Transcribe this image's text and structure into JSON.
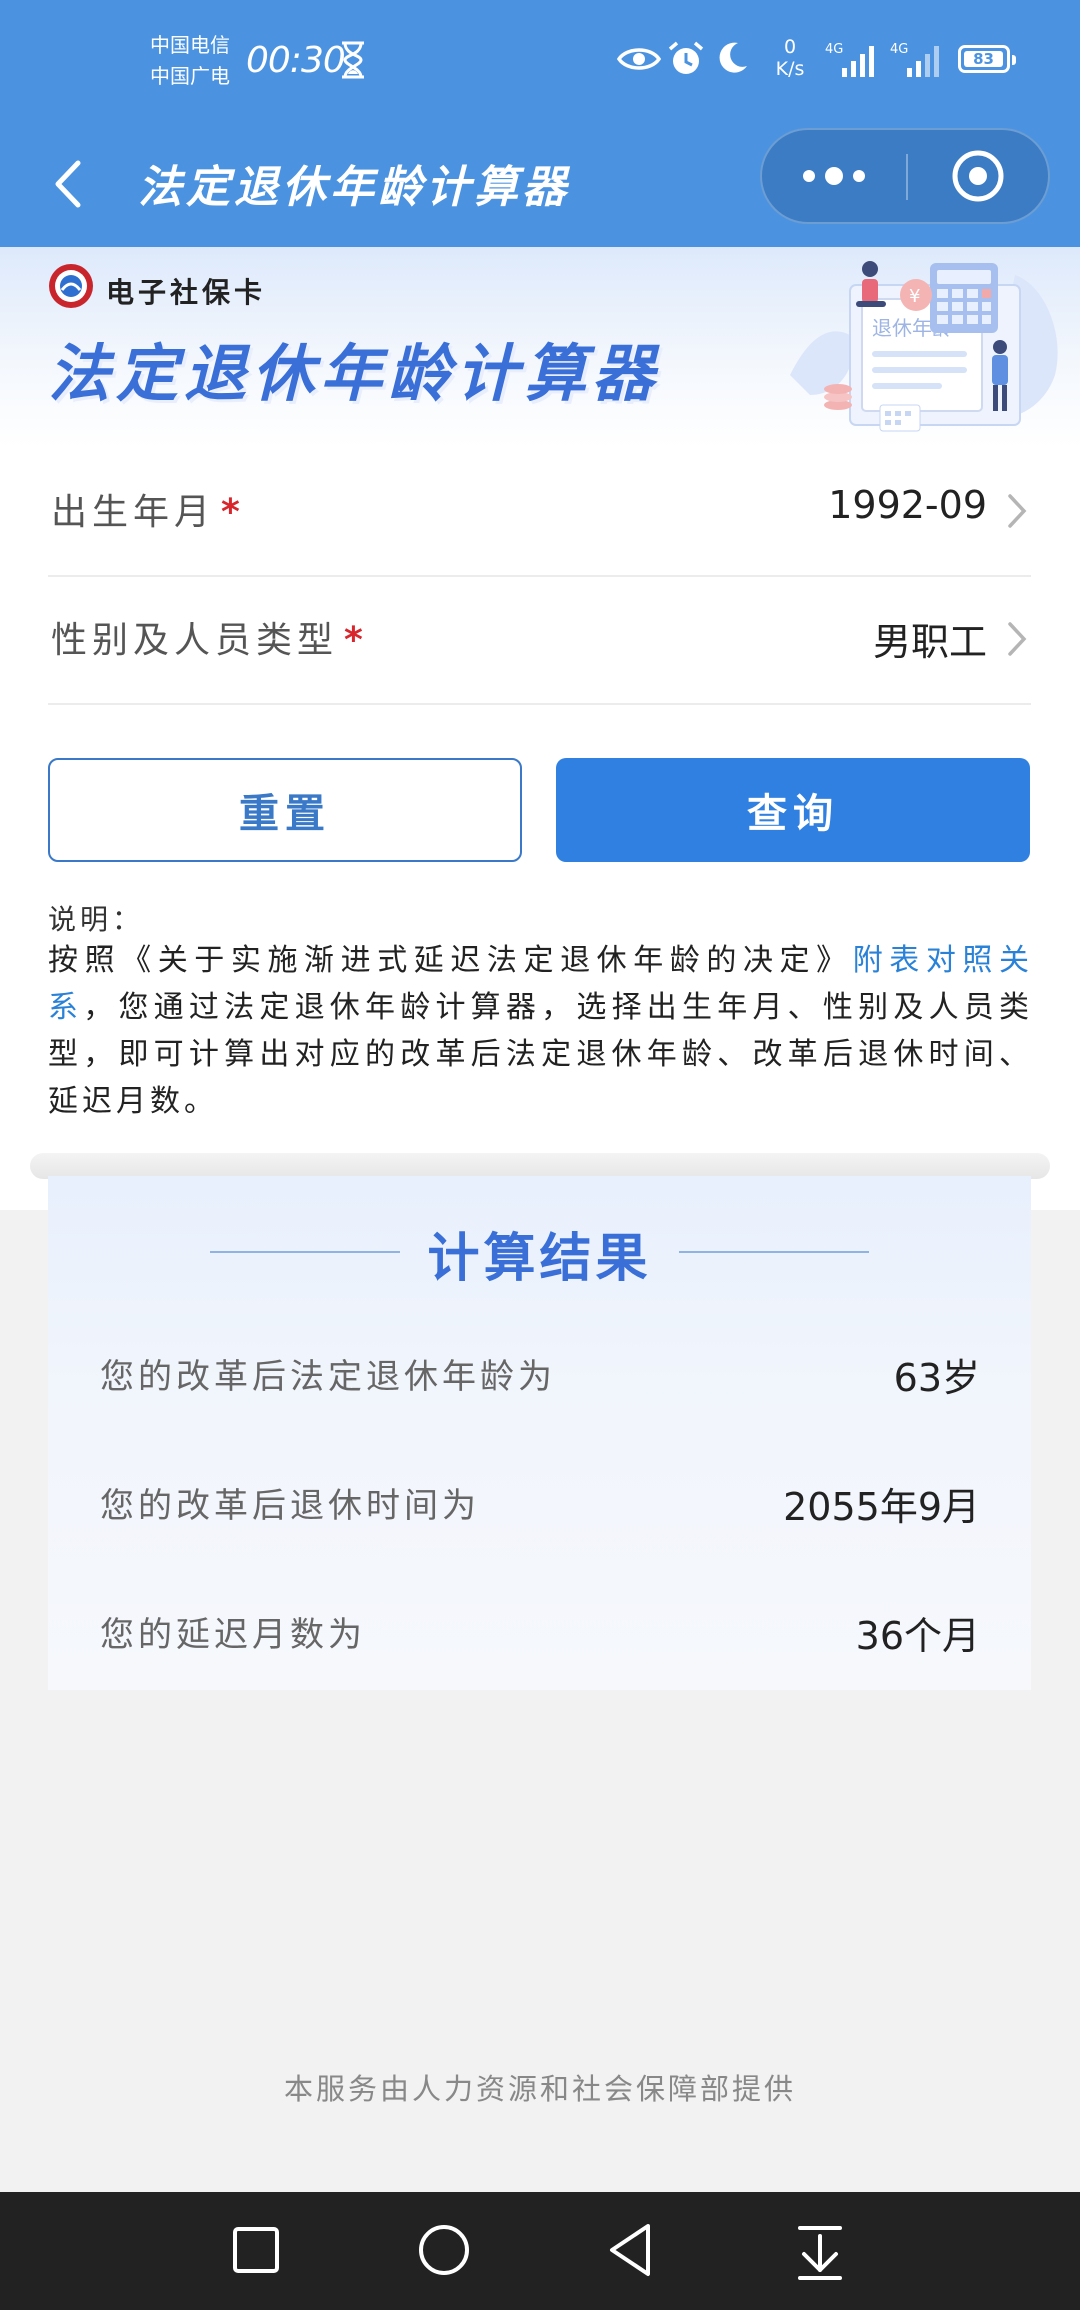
{
  "status_bar": {
    "carrier_1": "中国电信",
    "carrier_2": "中国广电",
    "time": "00:30",
    "net_speed_value": "0",
    "net_speed_unit": "K/s",
    "signal_1": "4G",
    "signal_2": "4G",
    "battery": "83",
    "icons": [
      "hourglass-icon",
      "eye-icon",
      "alarm-icon",
      "moon-icon",
      "signal-icon",
      "battery-icon"
    ]
  },
  "nav": {
    "title": "法定退休年龄计算器",
    "back_icon": "back-arrow-icon",
    "more_icon": "more-dots-icon",
    "close_icon": "target-close-icon"
  },
  "banner": {
    "brand": "电子社保卡",
    "title": "法定退休年龄计算器",
    "illustration_text": "退休年龄"
  },
  "form": {
    "birth": {
      "label": "出生年月",
      "required_mark": "*",
      "value": "1992-09"
    },
    "type": {
      "label": "性别及人员类型",
      "required_mark": "*",
      "value": "男职工"
    }
  },
  "buttons": {
    "reset": "重置",
    "query": "查询"
  },
  "notes": {
    "heading": "说明：",
    "text_before_link": "按照《关于实施渐进式延迟法定退休年龄的决定》",
    "link": "附表对照关系",
    "text_after_link": "，您通过法定退休年龄计算器，选择出生年月、性别及人员类型，即可计算出对应的改革后法定退休年龄、改革后退休时间、延迟月数。"
  },
  "result": {
    "title": "计算结果",
    "rows": [
      {
        "label": "您的改革后法定退休年龄为",
        "value": "63岁"
      },
      {
        "label": "您的改革后退休时间为",
        "value": "2055年9月"
      },
      {
        "label": "您的延迟月数为",
        "value": "36个月"
      }
    ]
  },
  "footer": "本服务由人力资源和社会保障部提供",
  "colors": {
    "header_blue": "#4b93e0",
    "title_blue": "#3a6fd8",
    "primary_button": "#2f80e0",
    "link": "#2a82d8",
    "required": "#d8262c"
  }
}
